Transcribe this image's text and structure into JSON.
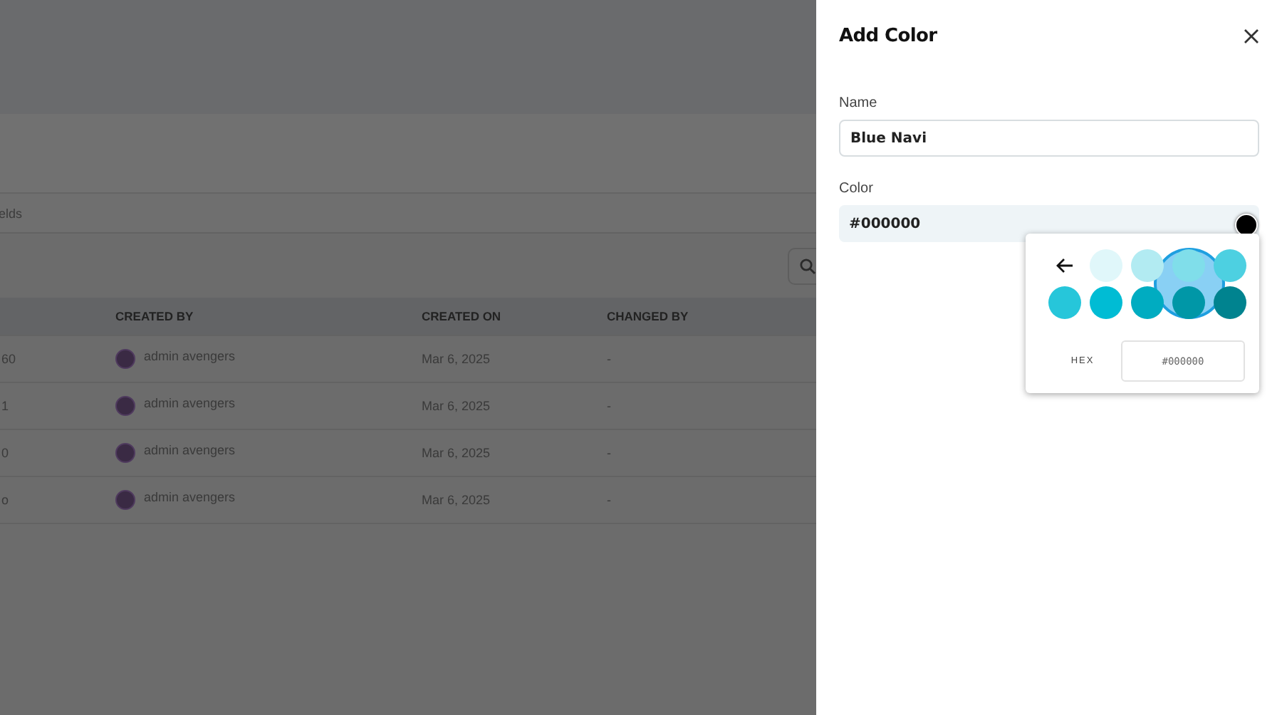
{
  "background": {
    "tab_fragment": "elds",
    "table": {
      "columns": [
        "CREATED BY",
        "CREATED ON",
        "CHANGED BY"
      ],
      "rows": [
        {
          "column_1": "60",
          "created_by": "admin avengers",
          "created_on": "Mar 6, 2025",
          "changed_by": "-"
        },
        {
          "column_1": "1",
          "created_by": "admin avengers",
          "created_on": "Mar 6, 2025",
          "changed_by": "-"
        },
        {
          "column_1": "0",
          "created_by": "admin avengers",
          "created_on": "Mar 6, 2025",
          "changed_by": "-"
        },
        {
          "column_1": "o",
          "created_by": "admin avengers",
          "created_on": "Mar 6, 2025",
          "changed_by": "-"
        }
      ]
    }
  },
  "panel": {
    "title": "Add Color",
    "name_field": {
      "label": "Name",
      "value": "Blue Navi"
    },
    "color_field": {
      "label": "Color",
      "value": "#000000",
      "color": "#000000"
    },
    "picker": {
      "swatches": [
        {
          "color": "#e0f7fa",
          "highlighted": false
        },
        {
          "color": "#b2ebf2",
          "highlighted": false
        },
        {
          "color": "#80deea",
          "highlighted": false
        },
        {
          "color": "#4dd0e1",
          "highlighted": false
        },
        {
          "color": "#26c6da",
          "highlighted": false
        },
        {
          "color": "#00bcd4",
          "highlighted": false
        },
        {
          "color": "#00acc1",
          "highlighted": false
        },
        {
          "color": "#0097a7",
          "highlighted": true
        },
        {
          "color": "#00838f",
          "highlighted": false
        }
      ],
      "hex_label": "HEX",
      "hex_value": "#000000"
    }
  }
}
